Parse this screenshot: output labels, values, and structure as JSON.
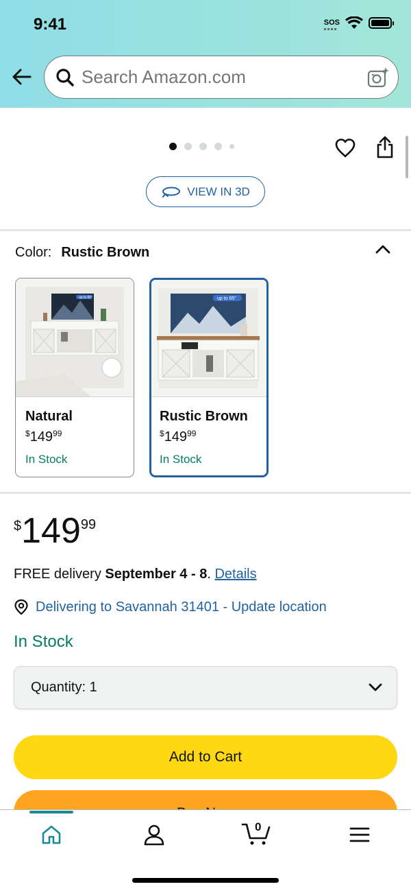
{
  "status_bar": {
    "time": "9:41",
    "sos": "SOS"
  },
  "search": {
    "placeholder": "Search Amazon.com"
  },
  "gallery": {
    "dot_count": 5,
    "active_index": 0,
    "view_3d_label": "VIEW IN 3D"
  },
  "color_selector": {
    "label": "Color:",
    "selected": "Rustic Brown",
    "options": [
      {
        "name": "Natural",
        "price_symbol": "$",
        "price_whole": "149",
        "price_fraction": "99",
        "stock": "In Stock",
        "badge": "up to 65\"",
        "selected": false
      },
      {
        "name": "Rustic Brown",
        "price_symbol": "$",
        "price_whole": "149",
        "price_fraction": "99",
        "stock": "In Stock",
        "badge": "up to 65\"",
        "selected": true
      }
    ]
  },
  "price": {
    "symbol": "$",
    "whole": "149",
    "fraction": "99"
  },
  "delivery": {
    "prefix": "FREE delivery ",
    "date": "September 4 - 8",
    "suffix": ". ",
    "details_link": "Details"
  },
  "location": {
    "text": "Delivering to Savannah 31401 - Update location"
  },
  "availability": "In Stock",
  "quantity": {
    "label": "Quantity:",
    "value": "1"
  },
  "buttons": {
    "add_to_cart": "Add to Cart",
    "buy_now": "Buy Now"
  },
  "bottom_nav": {
    "cart_count": "0"
  },
  "colors": {
    "link": "#2162a1",
    "stock_green": "#067d62",
    "add_to_cart": "#ffd814",
    "buy_now": "#ffa41c",
    "nav_active": "#1a8b96"
  }
}
